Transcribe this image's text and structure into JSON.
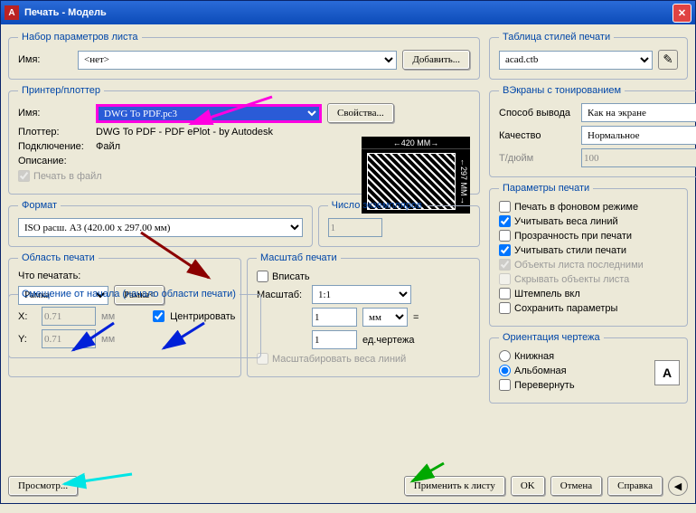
{
  "window": {
    "title": "Печать - Модель"
  },
  "pageSetup": {
    "legend": "Набор параметров листа",
    "nameLabel": "Имя:",
    "nameValue": "<нет>",
    "addBtn": "Добавить..."
  },
  "printer": {
    "legend": "Принтер/плоттер",
    "nameLabel": "Имя:",
    "nameValue": "DWG To PDF.pc3",
    "propsBtn": "Свойства...",
    "plotterLabel": "Плоттер:",
    "plotterValue": "DWG To PDF - PDF ePlot - by Autodesk",
    "connLabel": "Подключение:",
    "connValue": "Файл",
    "descLabel": "Описание:",
    "plotToFile": "Печать в файл",
    "preview": {
      "width": "420 MM",
      "height": "297 MM"
    }
  },
  "format": {
    "legend": "Формат",
    "value": "ISO расш. A3 (420.00 x 297.00 мм)"
  },
  "copies": {
    "legend": "Число экземпляров",
    "value": "1"
  },
  "plotArea": {
    "legend": "Область печати",
    "whatLabel": "Что печатать:",
    "whatValue": "Рамка",
    "windowBtn": "Рамка<"
  },
  "offset": {
    "legend": "Смещение от начала (начало области печати)",
    "xLabel": "X:",
    "xValue": "0.71",
    "xUnit": "мм",
    "yLabel": "Y:",
    "yValue": "0.71",
    "yUnit": "мм",
    "center": "Центрировать"
  },
  "scale": {
    "legend": "Масштаб печати",
    "fit": "Вписать",
    "scaleLabel": "Масштаб:",
    "scaleValue": "1:1",
    "num": "1",
    "numUnit": "мм",
    "eq": "=",
    "den": "1",
    "denUnit": "ед.чертежа",
    "scaleLW": "Масштабировать веса линий"
  },
  "styleTable": {
    "legend": "Таблица стилей печати",
    "value": "acad.ctb"
  },
  "shaded": {
    "legend": "ВЭкраны с тонированием",
    "methodLabel": "Способ вывода",
    "methodValue": "Как на экране",
    "qualityLabel": "Качество",
    "qualityValue": "Нормальное",
    "dpiLabel": "Т/дюйм",
    "dpiValue": "100"
  },
  "options": {
    "legend": "Параметры печати",
    "bg": "Печать в фоновом режиме",
    "lw": "Учитывать веса линий",
    "transp": "Прозрачность при печати",
    "styles": "Учитывать стили печати",
    "paperLast": "Объекты листа последними",
    "hide": "Скрывать объекты листа",
    "stamp": "Штемпель вкл",
    "save": "Сохранить параметры"
  },
  "orientation": {
    "legend": "Ориентация чертежа",
    "portrait": "Книжная",
    "landscape": "Альбомная",
    "upside": "Перевернуть",
    "iconLetter": "A"
  },
  "buttons": {
    "preview": "Просмотр...",
    "apply": "Применить к листу",
    "ok": "OK",
    "cancel": "Отмена",
    "help": "Справка"
  }
}
